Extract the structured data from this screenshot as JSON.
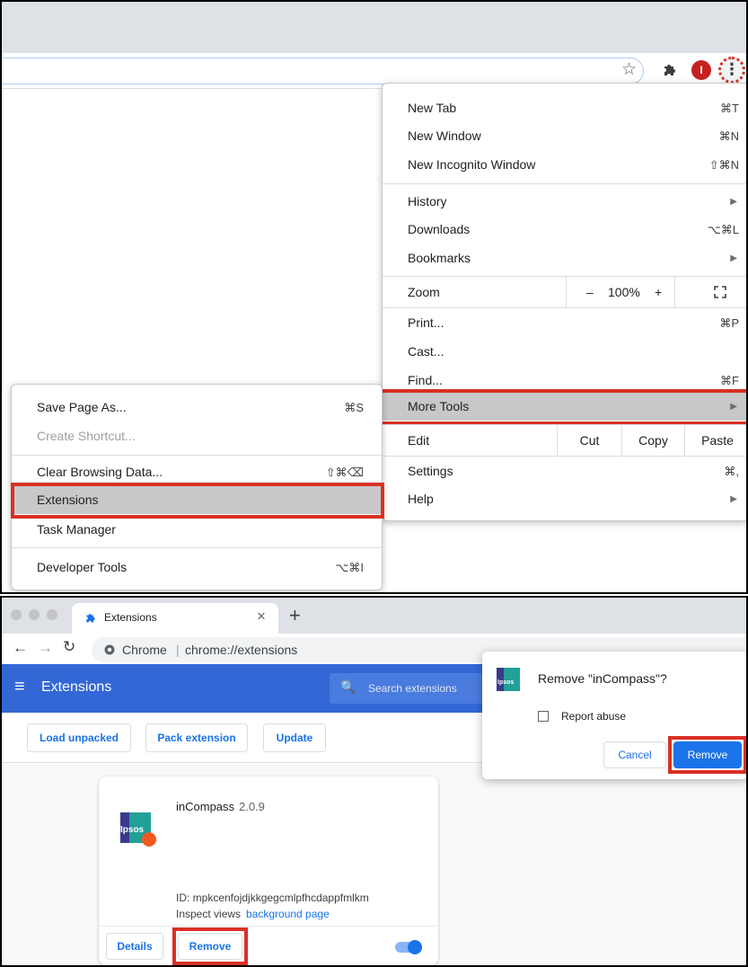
{
  "chrome_menu": {
    "new_tab": "New Tab",
    "new_tab_sc": "⌘T",
    "new_window": "New Window",
    "new_window_sc": "⌘N",
    "incognito": "New Incognito Window",
    "incognito_sc": "⇧⌘N",
    "history": "History",
    "downloads": "Downloads",
    "downloads_sc": "⌥⌘L",
    "bookmarks": "Bookmarks",
    "zoom": "Zoom",
    "zoom_minus": "–",
    "zoom_value": "100%",
    "zoom_plus": "+",
    "print": "Print...",
    "print_sc": "⌘P",
    "cast": "Cast...",
    "find": "Find...",
    "find_sc": "⌘F",
    "more_tools": "More Tools",
    "edit": "Edit",
    "cut": "Cut",
    "copy": "Copy",
    "paste": "Paste",
    "settings": "Settings",
    "settings_sc": "⌘,",
    "help": "Help"
  },
  "more_tools_menu": {
    "save_page": "Save Page As...",
    "save_page_sc": "⌘S",
    "create_shortcut": "Create Shortcut...",
    "clear_data": "Clear Browsing Data...",
    "clear_data_sc": "⇧⌘⌫",
    "extensions": "Extensions",
    "task_manager": "Task Manager",
    "dev_tools": "Developer Tools",
    "dev_tools_sc": "⌥⌘I"
  },
  "top_toolbar": {
    "avatar_initial": "I"
  },
  "browser": {
    "tab_title": "Extensions",
    "tab_close": "×",
    "new_tab": "+",
    "site_label": "Chrome",
    "url": "chrome://extensions"
  },
  "extensions_page": {
    "title": "Extensions",
    "search_placeholder": "Search extensions",
    "load_unpacked": "Load unpacked",
    "pack_extension": "Pack extension",
    "update": "Update"
  },
  "extension_card": {
    "name": "inCompass",
    "version": "2.0.9",
    "logo_text": "Ipsos",
    "id_line": "ID: mpkcenfojdjkkgegcmlpfhcdappfmlkm",
    "inspect_prefix": "Inspect views",
    "inspect_link": "background page",
    "details": "Details",
    "remove": "Remove",
    "enabled": true
  },
  "remove_dialog": {
    "logo_text": "Ipsos",
    "title": "Remove \"inCompass\"?",
    "report_abuse": "Report abuse",
    "cancel": "Cancel",
    "remove": "Remove"
  },
  "colors": {
    "highlight_red": "#d93025",
    "chrome_blue": "#1a73e8",
    "header_blue": "#3367d6"
  }
}
